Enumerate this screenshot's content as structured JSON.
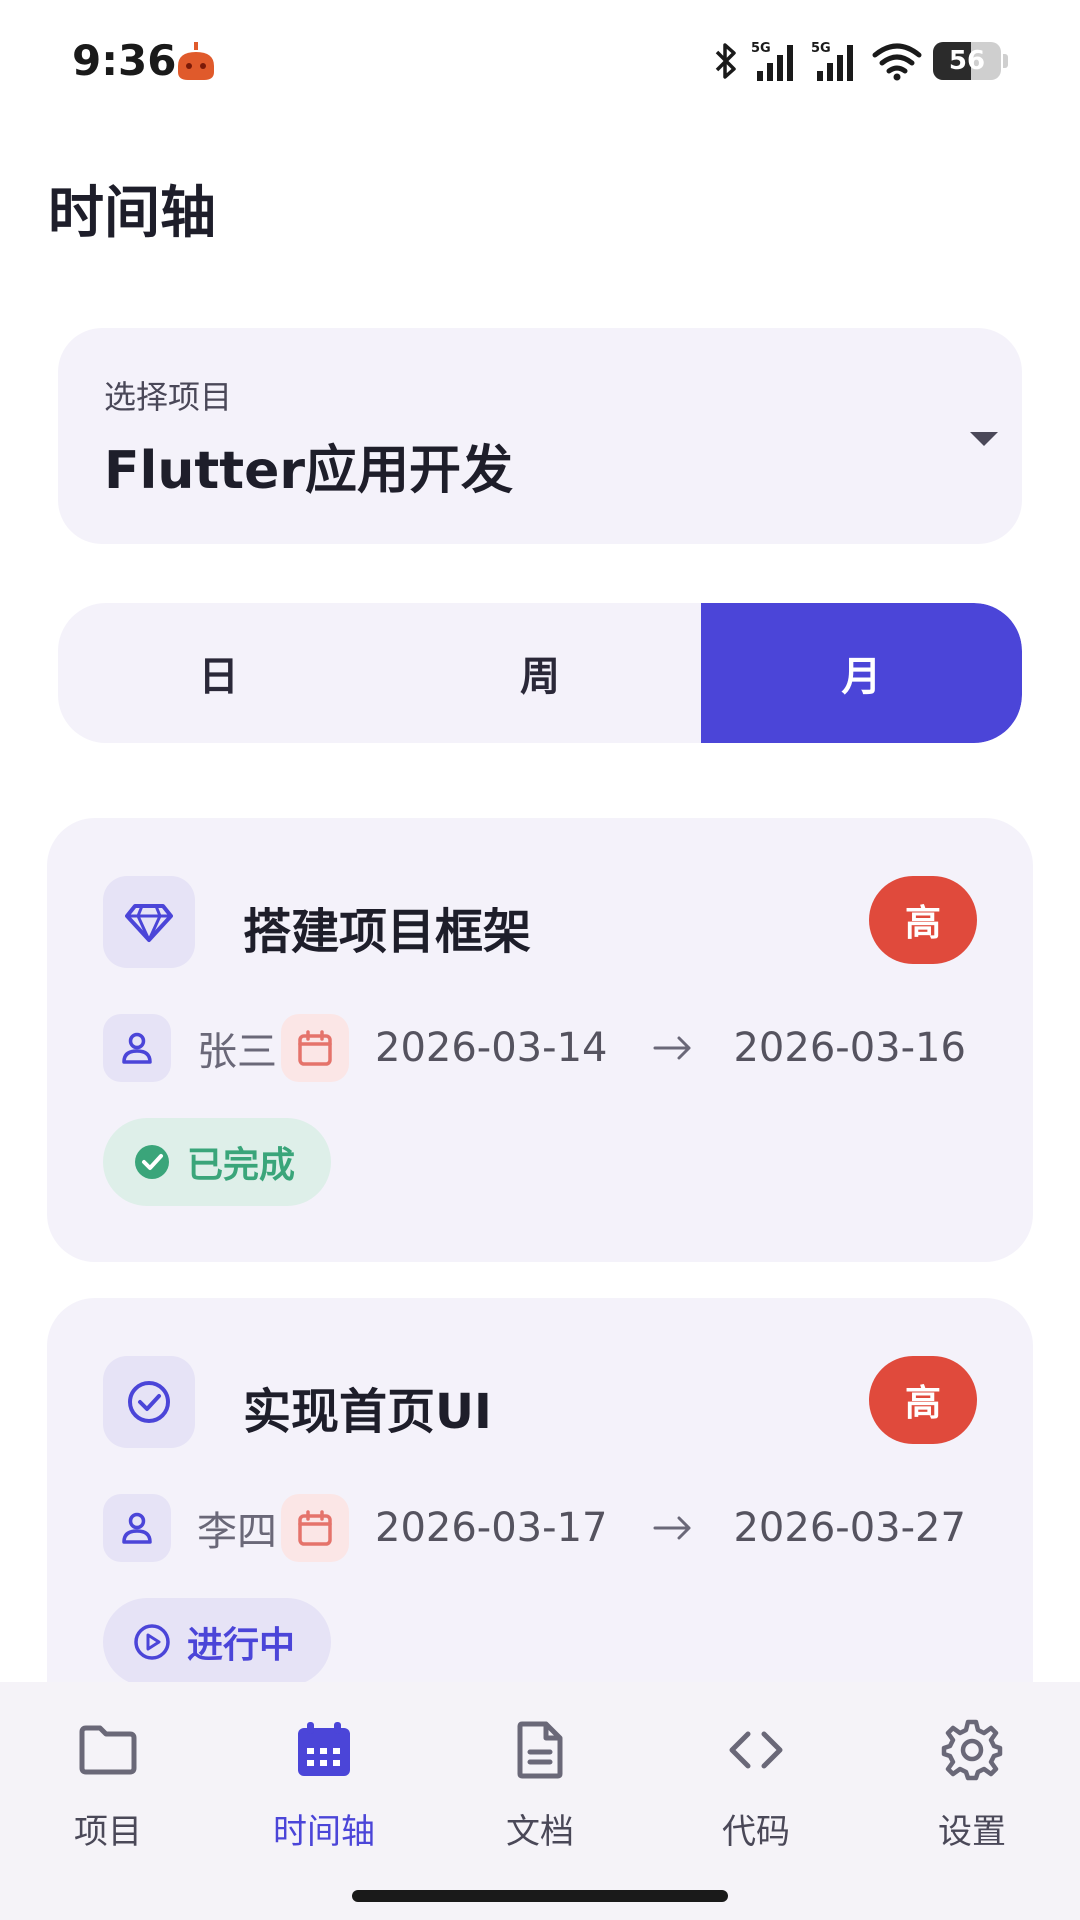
{
  "status_bar": {
    "time": "9:36",
    "network_1": "5G",
    "network_2": "5G",
    "battery": "56",
    "battery_level": 0.56
  },
  "header": {
    "title": "时间轴"
  },
  "project_select": {
    "label": "选择项目",
    "value": "Flutter应用开发"
  },
  "view_modes": {
    "items": [
      "日",
      "周",
      "月"
    ],
    "selected": "月"
  },
  "tasks": [
    {
      "title": "搭建项目框架",
      "icon": "diamond-icon",
      "priority": "高",
      "assignee": "张三",
      "start_date": "2026-03-14",
      "end_date": "2026-03-16",
      "status": "已完成",
      "status_icon": "check-circle-icon"
    },
    {
      "title": "实现首页UI",
      "icon": "check-circle-outline-icon",
      "priority": "高",
      "assignee": "李四",
      "start_date": "2026-03-17",
      "end_date": "2026-03-27",
      "status": "进行中",
      "status_icon": "play-circle-icon"
    }
  ],
  "bottom_nav": {
    "items": [
      {
        "label": "项目",
        "icon": "folder-icon"
      },
      {
        "label": "时间轴",
        "icon": "calendar-icon"
      },
      {
        "label": "文档",
        "icon": "document-icon"
      },
      {
        "label": "代码",
        "icon": "code-icon"
      },
      {
        "label": "设置",
        "icon": "gear-icon"
      }
    ],
    "active": "时间轴"
  },
  "colors": {
    "primary": "#4b45d8",
    "priority_high": "#e04a3c",
    "done": "#3aa57a",
    "surface": "#f4f2fa"
  }
}
